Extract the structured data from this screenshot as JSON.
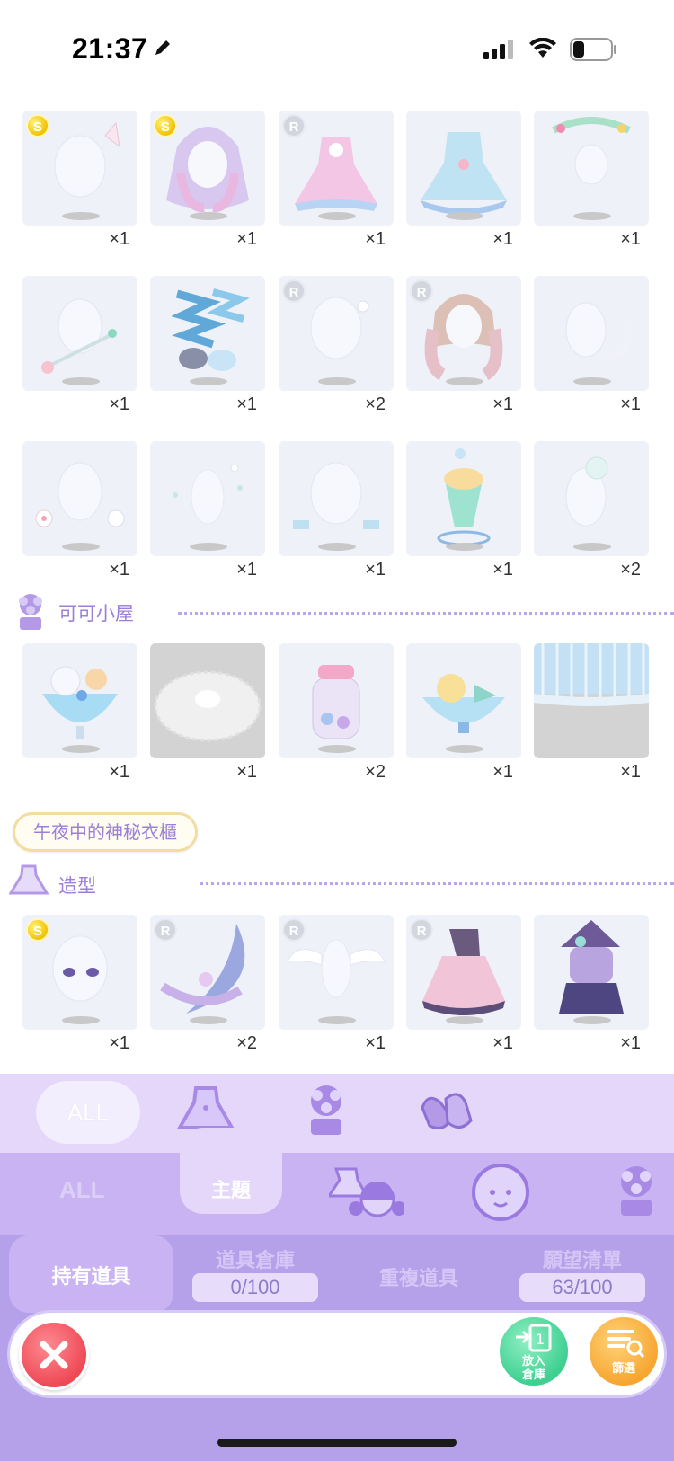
{
  "status_bar": {
    "time": "21:37"
  },
  "style_items": [
    [
      {
        "badge": "S",
        "qty": "×1",
        "icon": "cat-ears-icon"
      },
      {
        "badge": "S",
        "qty": "×1",
        "icon": "lavender-hair-icon"
      },
      {
        "badge": "R",
        "qty": "×1",
        "icon": "pink-dress-icon"
      },
      {
        "badge": "",
        "qty": "×1",
        "icon": "blue-dress-icon"
      },
      {
        "badge": "",
        "qty": "×1",
        "icon": "candy-headband-icon"
      }
    ],
    [
      {
        "badge": "",
        "qty": "×1",
        "icon": "wand-icon"
      },
      {
        "badge": "",
        "qty": "×1",
        "icon": "ribbon-boots-icon"
      },
      {
        "badge": "R",
        "qty": "×2",
        "icon": "white-ears-icon"
      },
      {
        "badge": "R",
        "qty": "×1",
        "icon": "pink-curls-icon"
      },
      {
        "badge": "",
        "qty": "×1",
        "icon": "cat-tail-icon"
      }
    ],
    [
      {
        "badge": "",
        "qty": "×1",
        "icon": "paw-gloves-icon"
      },
      {
        "badge": "",
        "qty": "×1",
        "icon": "sparkle-aura-icon"
      },
      {
        "badge": "",
        "qty": "×1",
        "icon": "wrist-bows-icon"
      },
      {
        "badge": "",
        "qty": "×1",
        "icon": "soda-float-icon"
      },
      {
        "badge": "",
        "qty": "×2",
        "icon": "cat-plush-icon"
      }
    ]
  ],
  "cocoa_section": {
    "title": "可可小屋"
  },
  "cocoa_items": [
    {
      "qty": "×1",
      "icon": "parfait-icon",
      "gray": false
    },
    {
      "qty": "×1",
      "icon": "lace-rug-icon",
      "gray": true
    },
    {
      "qty": "×2",
      "icon": "candy-jar-icon",
      "gray": false
    },
    {
      "qty": "×1",
      "icon": "dessert-bowl-icon",
      "gray": false
    },
    {
      "qty": "×1",
      "icon": "curtain-icon",
      "gray": true
    }
  ],
  "theme_name": "午夜中的神秘衣櫃",
  "styling_section": {
    "title": "造型"
  },
  "styling_items": [
    {
      "badge": "S",
      "qty": "×1",
      "icon": "purple-eyes-icon"
    },
    {
      "badge": "R",
      "qty": "×2",
      "icon": "crescent-moon-icon"
    },
    {
      "badge": "R",
      "qty": "×1",
      "icon": "angel-wings-icon"
    },
    {
      "badge": "R",
      "qty": "×1",
      "icon": "pink-skirt-icon"
    },
    {
      "badge": "",
      "qty": "×1",
      "icon": "witch-cat-icon"
    }
  ],
  "bottom": {
    "tier1_all": "ALL",
    "tier2_all": "ALL",
    "tier2_theme": "主題",
    "tabs": {
      "owned": "持有道具",
      "warehouse": "道具倉庫",
      "warehouse_count": "0/100",
      "duplicates": "重複道具",
      "wishlist": "願望清單",
      "wishlist_count": "63/100"
    },
    "store_label_1": "放入",
    "store_label_2": "倉庫",
    "filter_label": "篩選"
  },
  "colors": {
    "accent": "#b5a0ea",
    "section_title": "#9b7fd8",
    "close": "#ee4a56",
    "store": "#3fcf91",
    "filter": "#f7a631"
  }
}
